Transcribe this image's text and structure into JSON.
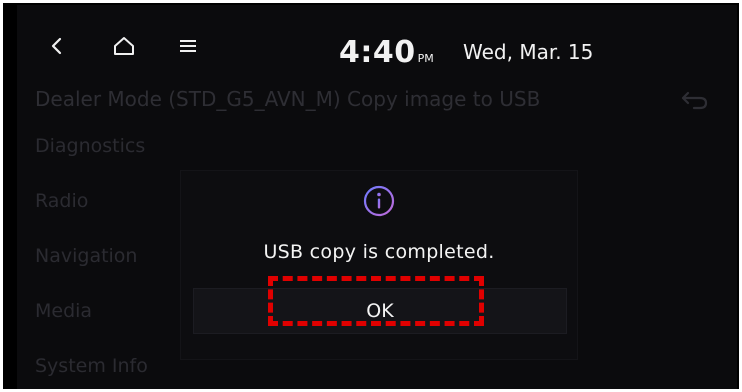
{
  "status_bar": {
    "time": "4:40",
    "ampm": "PM",
    "date": "Wed, Mar. 15",
    "icons": [
      "back-icon",
      "home-icon",
      "menu-icon"
    ]
  },
  "background": {
    "title": "Dealer Mode (STD_G5_AVN_M)  Copy image to USB",
    "menu_items": [
      "Diagnostics",
      "Radio",
      "Navigation",
      "Media",
      "System Info"
    ]
  },
  "dialog": {
    "icon": "info-icon",
    "message": "USB copy is completed.",
    "ok_label": "OK"
  },
  "colors": {
    "screen_bg": "#0b0b0d",
    "text": "#f4f4f4",
    "dim_text": "#2b2b31",
    "icon_accent": "#8f6cff",
    "highlight": "#e00000"
  }
}
